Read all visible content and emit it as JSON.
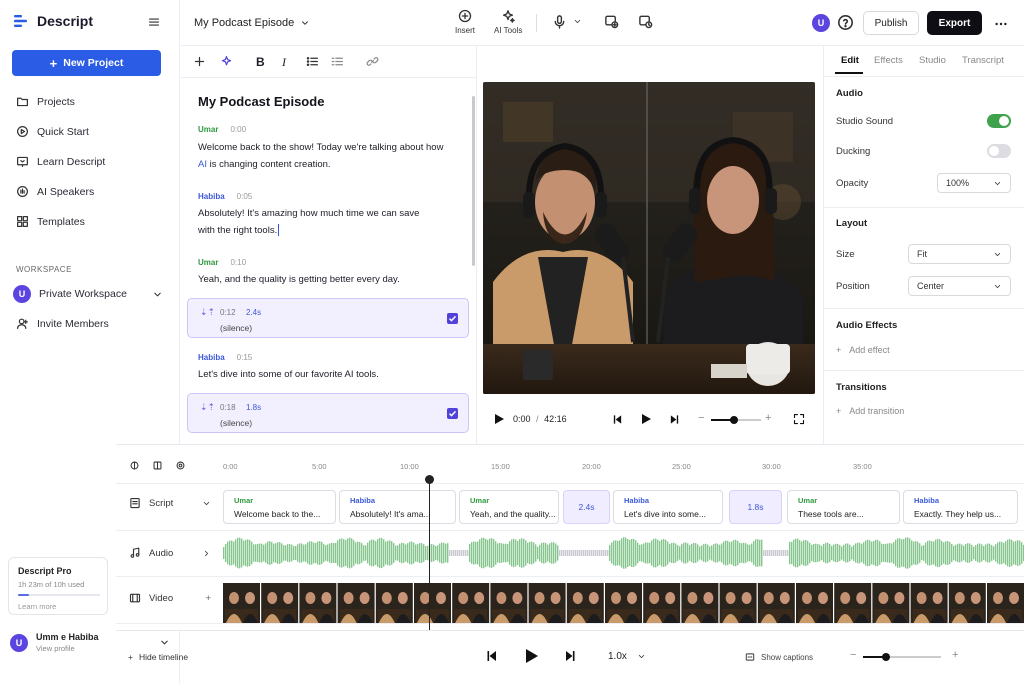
{
  "app": {
    "name": "Descript"
  },
  "sidebar": {
    "new_project_label": "New Project",
    "items": [
      {
        "label": "Projects",
        "icon": "folder-icon"
      },
      {
        "label": "Quick Start",
        "icon": "play-circle-icon"
      },
      {
        "label": "Learn Descript",
        "icon": "learn-icon"
      },
      {
        "label": "AI Speakers",
        "icon": "ai-speakers-icon"
      },
      {
        "label": "Templates",
        "icon": "templates-icon"
      }
    ],
    "workspace_title": "WORKSPACE",
    "workspace": {
      "avatar": "U",
      "name": "Private Workspace"
    },
    "invite_label": "Invite Members",
    "pro": {
      "title": "Descript Pro",
      "usage": "1h 23m of 10h used",
      "usage_fraction": 0.14,
      "learn_more": "Learn more"
    },
    "user": {
      "avatar": "U",
      "name": "Umm e Habiba",
      "sub": "View profile"
    }
  },
  "topbar": {
    "doc_title": "My Podcast Episode",
    "insert_label": "Insert",
    "ai_tools_label": "AI Tools",
    "avatar": "U",
    "publish_label": "Publish",
    "export_label": "Export"
  },
  "editor": {
    "title": "My Podcast Episode",
    "blocks": [
      {
        "speaker": "Umar",
        "time": "0:00",
        "line1_pre": "Welcome back to the show! Today we're talking about how",
        "line2_ai": "AI",
        "line2_rest": " is changing content creation."
      },
      {
        "speaker": "Habiba",
        "time": "0:05",
        "line1": "Absolutely! It's amazing how much time we can save",
        "line2": "with the right tools."
      },
      {
        "speaker": "Umar",
        "time": "0:10",
        "line1": "Yeah, and the quality is getting better every day."
      },
      {
        "speaker": "Habiba",
        "time": "0:15",
        "line1": "Let's dive into some of our favorite AI tools."
      }
    ],
    "silences": [
      {
        "time": "0:12",
        "duration": "2.4s",
        "label": "(silence)"
      },
      {
        "time": "0:18",
        "duration": "1.8s",
        "label": "(silence)"
      }
    ]
  },
  "player": {
    "current": "0:00",
    "sep": "/",
    "total": "42:16",
    "volume": 0.45
  },
  "panel": {
    "tabs": [
      "Edit",
      "Effects",
      "Studio",
      "Transcript"
    ],
    "audio_title": "Audio",
    "studio_sound_label": "Studio Sound",
    "studio_sound_on": true,
    "ducking_label": "Ducking",
    "ducking_on": false,
    "opacity_label": "Opacity",
    "opacity_value": "100%",
    "layout_title": "Layout",
    "size_label": "Size",
    "size_value": "Fit",
    "position_label": "Position",
    "position_value": "Center",
    "effects_title": "Audio Effects",
    "add_effect": "Add effect",
    "transitions_title": "Transitions",
    "add_transition": "Add transition"
  },
  "timeline": {
    "ruler": [
      "0:00",
      "5:00",
      "10:00",
      "15:00",
      "20:00",
      "25:00",
      "30:00",
      "35:00"
    ],
    "tracks": {
      "script": "Script",
      "audio": "Audio",
      "video": "Video"
    },
    "clips": [
      {
        "speaker": "Umar",
        "text": "Welcome back to the..."
      },
      {
        "speaker": "Habiba",
        "text": "Absolutely! It's ama..."
      },
      {
        "speaker": "Umar",
        "text": "Yeah, and the quality..."
      },
      {
        "silence": "2.4s"
      },
      {
        "speaker": "Habiba",
        "text": "Let's dive into some..."
      },
      {
        "silence": "1.8s"
      },
      {
        "speaker": "Umar",
        "text": "These tools are..."
      },
      {
        "speaker": "Habiba",
        "text": "Exactly. They help us..."
      }
    ]
  },
  "bottom": {
    "hide_timeline": "Hide timeline",
    "speed": "1.0x",
    "captions": "Show captions",
    "zoom": 0.3
  },
  "colors": {
    "accent": "#2b5ce6",
    "umar": "#2e9a3e",
    "habiba": "#3b58d9",
    "waveform": "#86c68e",
    "silence": "#c8c8d0"
  }
}
